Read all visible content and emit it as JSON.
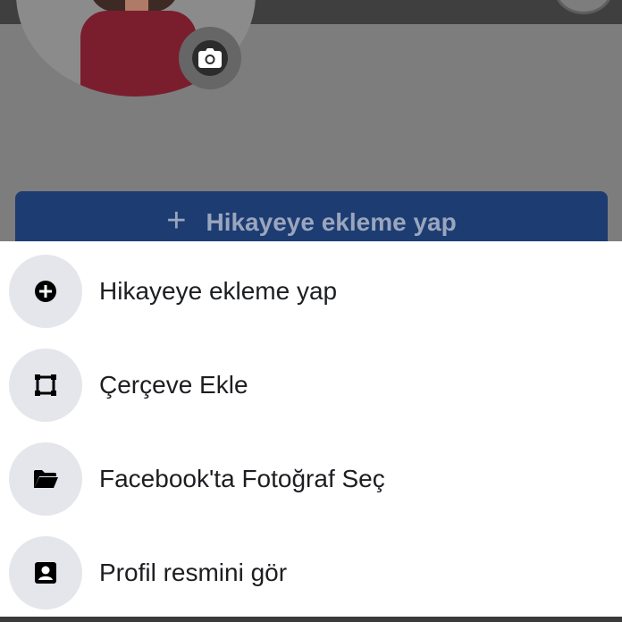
{
  "background": {
    "story_button_label": "Hikayeye ekleme yap",
    "story_button_plus": "+"
  },
  "sheet": {
    "items": [
      {
        "label": "Hikayeye ekleme yap",
        "icon": "add-circle-icon"
      },
      {
        "label": "Çerçeve Ekle",
        "icon": "frame-icon"
      },
      {
        "label": "Facebook'ta Fotoğraf Seç",
        "icon": "folder-icon"
      },
      {
        "label": "Profil resmini gör",
        "icon": "profile-picture-icon"
      }
    ]
  },
  "colors": {
    "story_button_bg": "#1d3c72",
    "sheet_bg": "#ffffff",
    "icon_circle_bg": "#e4e6eb",
    "text": "#1c1e21"
  }
}
